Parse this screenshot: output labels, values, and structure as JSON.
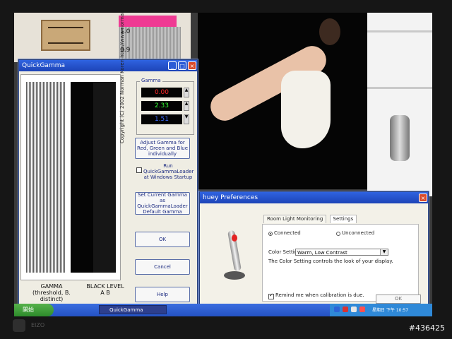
{
  "desktop": {
    "ruler": {
      "value_top": "1.0",
      "value_mid": "0.9"
    }
  },
  "quickgamma": {
    "title": "QuickGamma",
    "gamma_label": "Gamma",
    "values": [
      {
        "value": "0.00",
        "color": "#ff2b2b"
      },
      {
        "value": "2.33",
        "color": "#33ff33"
      },
      {
        "value": "1.51",
        "color": "#3d6dff"
      }
    ],
    "buttons": {
      "adjust": "Adjust Gamma for Red, Green and Blue individually",
      "run_loader": "Run QuickGammaLoader at Windows Startup",
      "set_default": "Set Current Gamma as QuickGammaLoader Default Gamma",
      "ok": "OK",
      "cancel": "Cancel",
      "help": "Help"
    },
    "labels": {
      "gamma_threshold": "GAMMA\n(threshold, B. distinct)",
      "black_level": "BLACK LEVEL\nA      B",
      "copyright": "Copyright (C) 2002   Norman Koren   http://www.normankoren.com"
    }
  },
  "huey": {
    "title": "huey Preferences",
    "tabs": [
      "Room Light Monitoring",
      "Settings"
    ],
    "radio_connected": "Connected",
    "radio_unconnected": "Unconnected",
    "color_setting_label": "Color Setting",
    "color_setting_value": "Warm, Low Contrast",
    "description": "The Color Setting controls the look of your display.",
    "reminder_text": "Remind me when calibration is due.",
    "ok": "OK"
  },
  "taskbar": {
    "start_label": "開始",
    "task": "QuickGamma",
    "tray_text": "星期日 下午 10:57"
  },
  "brand": "EIZO",
  "watermark": "#436425"
}
